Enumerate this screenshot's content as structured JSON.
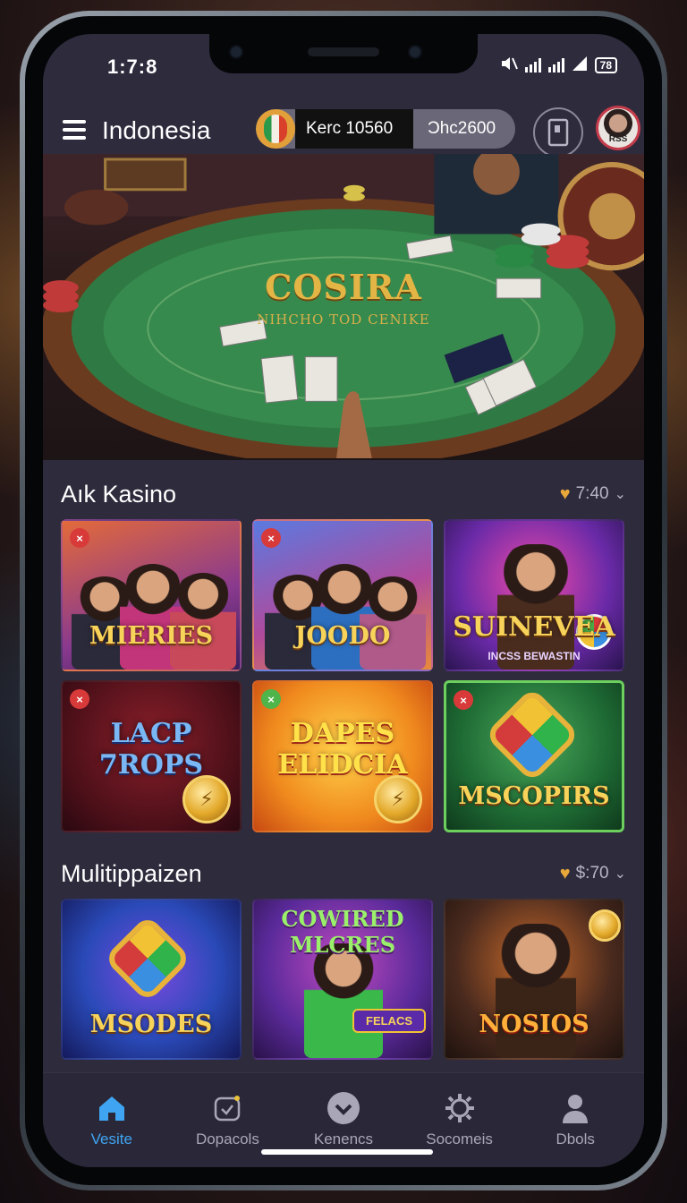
{
  "status": {
    "time": "1:7:8",
    "battery": "78"
  },
  "header": {
    "region": "Indonesia",
    "balance_primary": "Kerc 10560",
    "balance_secondary": "Ͻhc2600",
    "avatar_caption": "RSS"
  },
  "hero": {
    "title": "COSIRA",
    "subtitle": "NIHCHO TOD CENIKE"
  },
  "section1": {
    "title": "Aık Kasino",
    "meta": "7:40",
    "tiles": [
      {
        "name": "MIERIES",
        "sub": "",
        "badge_color": "#d83a3a"
      },
      {
        "name": "JOODO",
        "sub": "",
        "badge_color": "#d83a3a"
      },
      {
        "name": "SUINEVEA",
        "sub": "INCSS BEWASTIN",
        "badge_color": ""
      },
      {
        "name": "LACP 7ROPS",
        "sub": "",
        "badge_color": "#d83a3a"
      },
      {
        "name": "DAPES ELIDCIA",
        "sub": "",
        "badge_color": "#4fb54a"
      },
      {
        "name": "MSCOPIRS",
        "sub": "",
        "badge_color": "#d83a3a"
      }
    ]
  },
  "section2": {
    "title": "Mulitippaizen",
    "meta": "$:70",
    "tiles": [
      {
        "name": "MSODES",
        "sub": ""
      },
      {
        "name": "COWIRED MLCRES",
        "sub": "FELACS"
      },
      {
        "name": "NOSIOS",
        "sub": ""
      }
    ]
  },
  "nav": [
    {
      "label": "Vesite",
      "icon": "home-icon"
    },
    {
      "label": "Dopacols",
      "icon": "deposit-icon"
    },
    {
      "label": "Kenencs",
      "icon": "check-icon"
    },
    {
      "label": "Socomeis",
      "icon": "settings-icon"
    },
    {
      "label": "Dbols",
      "icon": "profile-icon"
    }
  ],
  "colors": {
    "accent": "#3fa5f3",
    "gold": "#e3b545",
    "surface": "#2e2b3d"
  }
}
